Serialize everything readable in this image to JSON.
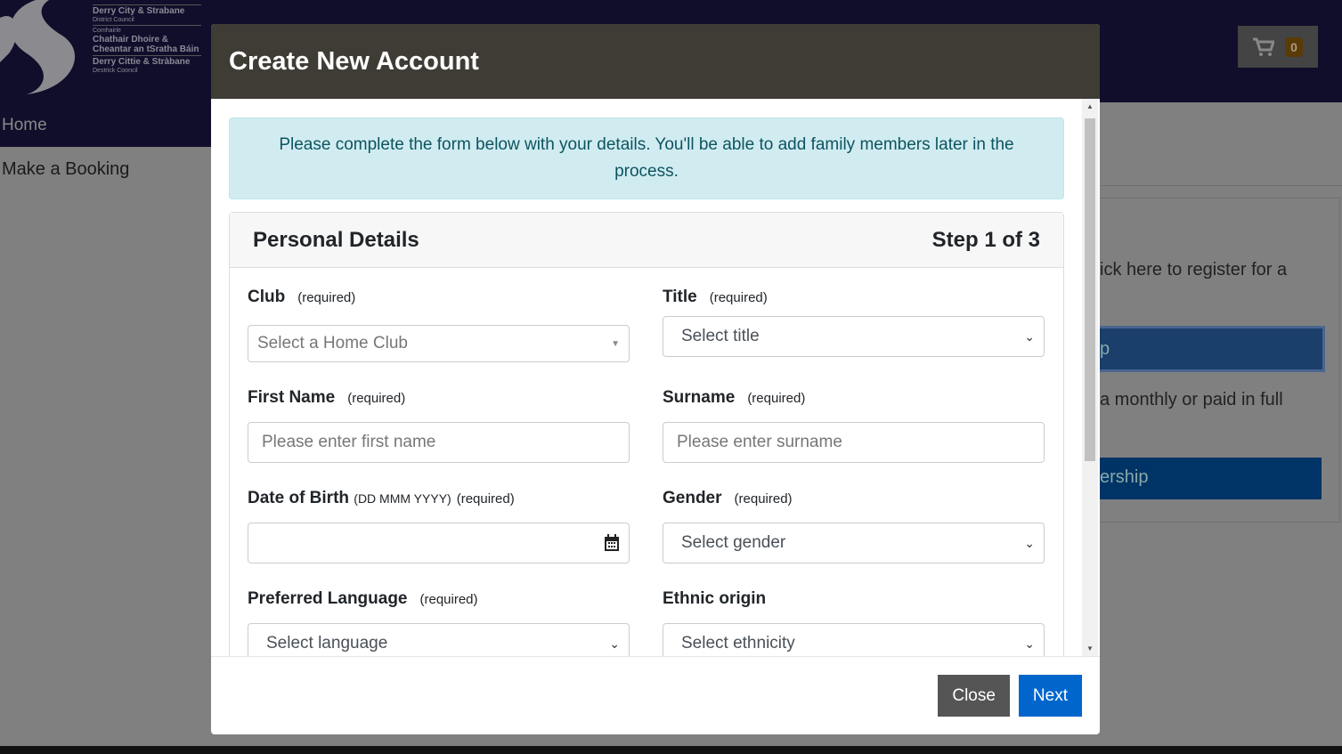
{
  "site": {
    "logo": {
      "line1": "Derry City & Strabane",
      "line1_sub": "District Council",
      "line2_sub": "Comhairle",
      "line2a": "Chathair Dhoire &",
      "line2b": "Cheantar an tSratha Báin",
      "line3": "Derry Cittie & Stràbane",
      "line3_sub": "Destrick Cooncil"
    },
    "cart_count": "0",
    "nav": {
      "home": "Home",
      "booking": "Make a Booking"
    },
    "bg_text1": "ick here to register for a",
    "bg_btn1": "p",
    "bg_text2": "a monthly or paid in full",
    "bg_btn2": "ership"
  },
  "modal": {
    "title": "Create New Account",
    "alert": "Please complete the form below with your details. You'll be able to add family members later in the process.",
    "section": "Personal Details",
    "step": "Step 1 of 3",
    "fields": [
      {
        "label": "Club",
        "required": "(required)",
        "value": "Select a Home Club"
      },
      {
        "label": "Title",
        "required": "(required)",
        "value": "Select title"
      },
      {
        "label": "First Name",
        "required": "(required)",
        "placeholder": "Please enter first name"
      },
      {
        "label": "Surname",
        "required": "(required)",
        "placeholder": "Please enter surname"
      },
      {
        "label": "Date of Birth",
        "hint": "(DD MMM YYYY)",
        "required": "(required)",
        "value": ""
      },
      {
        "label": "Gender",
        "required": "(required)",
        "value": "Select gender"
      },
      {
        "label": "Preferred Language",
        "required": "(required)",
        "value": "Select language"
      },
      {
        "label": "Ethnic origin",
        "value": "Select ethnicity"
      }
    ],
    "close": "Close",
    "next": "Next"
  }
}
